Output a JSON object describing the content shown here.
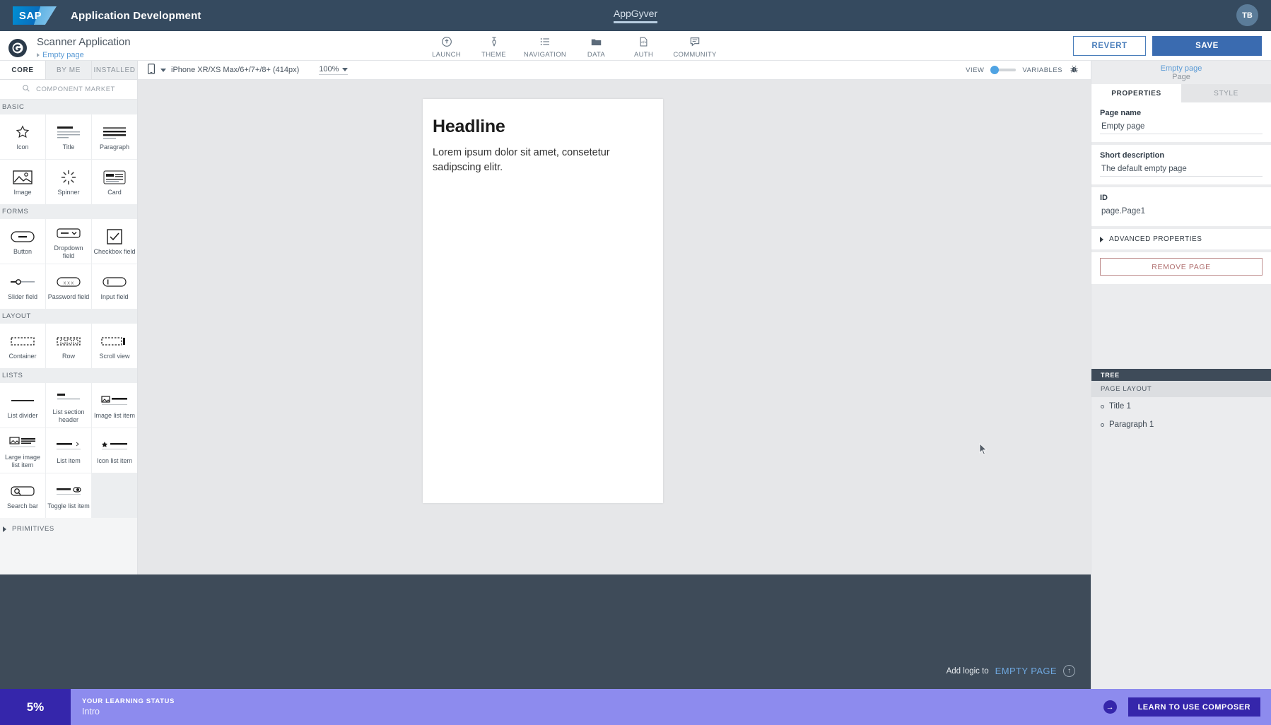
{
  "sap_bar": {
    "logo_text": "SAP",
    "title": "Application Development",
    "center_tab": "AppGyver",
    "avatar_initials": "TB"
  },
  "app_header": {
    "logo_glyph": "G",
    "project_name": "Scanner Application",
    "breadcrumb": "Empty page",
    "nav_tools": [
      {
        "label": "LAUNCH",
        "icon": "launch-icon"
      },
      {
        "label": "THEME",
        "icon": "theme-icon"
      },
      {
        "label": "NAVIGATION",
        "icon": "navigation-icon"
      },
      {
        "label": "DATA",
        "icon": "data-icon"
      },
      {
        "label": "AUTH",
        "icon": "auth-icon"
      },
      {
        "label": "COMMUNITY",
        "icon": "community-icon"
      }
    ],
    "revert_label": "REVERT",
    "save_label": "SAVE"
  },
  "toolbar": {
    "device": "iPhone XR/XS Max/6+/7+/8+ (414px)",
    "zoom": "100%",
    "view_label": "VIEW",
    "variables_label": "VARIABLES",
    "debug_icon": "bug-icon"
  },
  "left_panel": {
    "tabs": [
      {
        "label": "CORE",
        "active": true
      },
      {
        "label": "BY ME",
        "active": false
      },
      {
        "label": "INSTALLED",
        "active": false
      }
    ],
    "market_label": "COMPONENT MARKET",
    "sections": [
      {
        "title": "BASIC",
        "items": [
          {
            "name": "Icon",
            "icon": "star-icon"
          },
          {
            "name": "Title",
            "icon": "title-icon"
          },
          {
            "name": "Paragraph",
            "icon": "paragraph-icon"
          },
          {
            "name": "Image",
            "icon": "image-icon"
          },
          {
            "name": "Spinner",
            "icon": "spinner-icon"
          },
          {
            "name": "Card",
            "icon": "card-icon"
          }
        ]
      },
      {
        "title": "FORMS",
        "items": [
          {
            "name": "Button",
            "icon": "button-icon"
          },
          {
            "name": "Dropdown field",
            "icon": "dropdown-icon"
          },
          {
            "name": "Checkbox field",
            "icon": "checkbox-icon"
          },
          {
            "name": "Slider field",
            "icon": "slider-icon"
          },
          {
            "name": "Password field",
            "icon": "password-icon"
          },
          {
            "name": "Input field",
            "icon": "input-icon"
          }
        ]
      },
      {
        "title": "LAYOUT",
        "items": [
          {
            "name": "Container",
            "icon": "container-icon"
          },
          {
            "name": "Row",
            "icon": "row-icon"
          },
          {
            "name": "Scroll view",
            "icon": "scrollview-icon"
          }
        ]
      },
      {
        "title": "LISTS",
        "items": [
          {
            "name": "List divider",
            "icon": "list-divider-icon"
          },
          {
            "name": "List section header",
            "icon": "list-section-header-icon"
          },
          {
            "name": "Image list item",
            "icon": "image-list-item-icon"
          },
          {
            "name": "Large image list item",
            "icon": "large-image-list-item-icon"
          },
          {
            "name": "List item",
            "icon": "list-item-icon"
          },
          {
            "name": "Icon list item",
            "icon": "icon-list-item-icon"
          },
          {
            "name": "Search bar",
            "icon": "search-bar-icon"
          },
          {
            "name": "Toggle list item",
            "icon": "toggle-list-item-icon"
          }
        ]
      }
    ],
    "primitives_label": "PRIMITIVES"
  },
  "canvas": {
    "phone_title": "Headline",
    "phone_paragraph": "Lorem ipsum dolor sit amet, consetetur sadipscing elitr."
  },
  "logic_bar": {
    "prefix": "Add logic to",
    "target": "EMPTY PAGE",
    "icon": "arrow-up-circle-icon"
  },
  "right_panel": {
    "header_name": "Empty page",
    "header_sub": "Page",
    "tabs": [
      {
        "label": "PROPERTIES",
        "active": true
      },
      {
        "label": "STYLE",
        "active": false
      }
    ],
    "fields": [
      {
        "label": "Page name",
        "value": "Empty page",
        "underline": true
      },
      {
        "label": "Short description",
        "value": "The default empty page",
        "underline": true
      },
      {
        "label": "ID",
        "value": "page.Page1",
        "underline": false
      }
    ],
    "advanced_label": "ADVANCED PROPERTIES",
    "remove_label": "REMOVE PAGE",
    "tree_title": "TREE",
    "tree_subtitle": "PAGE LAYOUT",
    "tree_items": [
      {
        "label": "Title 1"
      },
      {
        "label": "Paragraph 1"
      }
    ]
  },
  "learning": {
    "percent": "5%",
    "status_label": "YOUR LEARNING STATUS",
    "status_value": "Intro",
    "cta_label": "LEARN TO USE COMPOSER",
    "arrow_icon": "arrow-right-icon"
  }
}
